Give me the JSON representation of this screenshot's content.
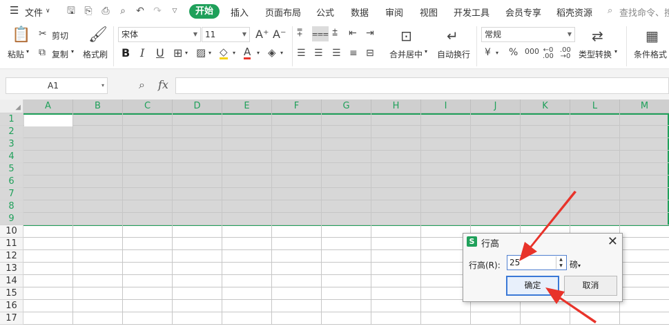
{
  "menubar": {
    "file_label": "文件",
    "tabs": [
      "开始",
      "插入",
      "页面布局",
      "公式",
      "数据",
      "审阅",
      "视图",
      "开发工具",
      "会员专享",
      "稻壳资源"
    ],
    "search_placeholder": "查找命令、搜"
  },
  "ribbon": {
    "paste_label": "粘贴",
    "cut_label": "剪切",
    "copy_label": "复制",
    "format_painter_label": "格式刷",
    "font_name": "宋体",
    "font_size": "11",
    "merge_center_label": "合并居中",
    "wrap_text_label": "自动换行",
    "number_format": "常规",
    "type_convert_label": "类型转换",
    "conditional_format_label": "条件格式"
  },
  "formula_bar": {
    "cell_ref": "A1",
    "fx_label": "fx"
  },
  "grid": {
    "columns": [
      "A",
      "B",
      "C",
      "D",
      "E",
      "F",
      "G",
      "H",
      "I",
      "J",
      "K",
      "L",
      "M"
    ],
    "rows": [
      "1",
      "2",
      "3",
      "4",
      "5",
      "6",
      "7",
      "8",
      "9",
      "10",
      "11",
      "12",
      "13",
      "14",
      "15",
      "16",
      "17"
    ],
    "selected_rows": [
      "1",
      "2",
      "3",
      "4",
      "5",
      "6",
      "7",
      "8",
      "9"
    ]
  },
  "dialog": {
    "icon_letter": "S",
    "title": "行高",
    "row_height_label": "行高(R):",
    "row_height_value": "25",
    "unit": "磅",
    "ok_label": "确定",
    "cancel_label": "取消"
  },
  "colors": {
    "accent_green": "#1fa05a",
    "arrow_red": "#e8332a",
    "selection_gray": "#d7d7d7"
  }
}
